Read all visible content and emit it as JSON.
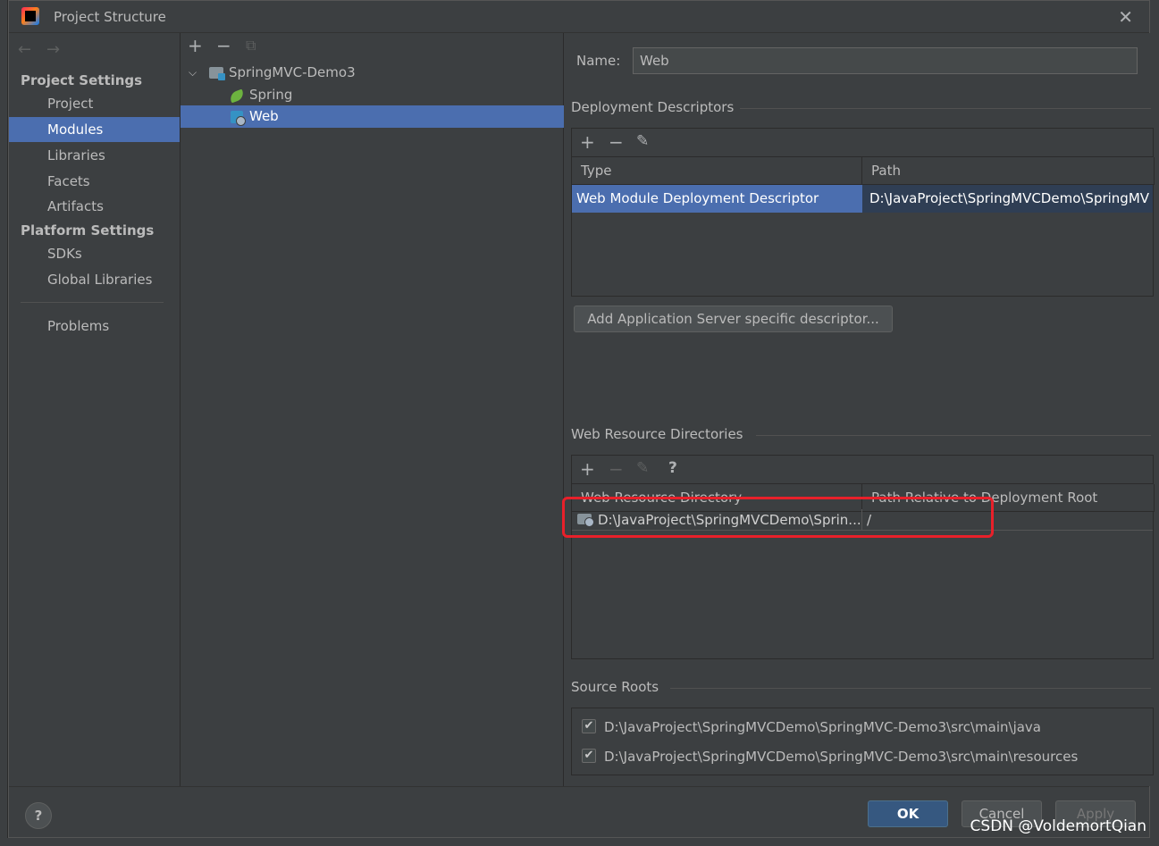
{
  "window": {
    "title": "Project Structure"
  },
  "nav": {
    "back_icon": "arrow-left-icon",
    "forward_icon": "arrow-right-icon",
    "project_settings_heading": "Project Settings",
    "project_items": [
      "Project",
      "Modules",
      "Libraries",
      "Facets",
      "Artifacts"
    ],
    "selected_item": "Modules",
    "platform_settings_heading": "Platform Settings",
    "platform_items": [
      "SDKs",
      "Global Libraries"
    ],
    "problems_label": "Problems"
  },
  "tree": {
    "toolbar": {
      "add": "+",
      "remove": "−",
      "copy_icon": "copy-icon"
    },
    "root": "SpringMVC-Demo3",
    "children": [
      "Spring",
      "Web"
    ],
    "selected": "Web"
  },
  "facet": {
    "name_label": "Name:",
    "name_value": "Web",
    "deployment": {
      "title": "Deployment Descriptors",
      "columns": [
        "Type",
        "Path"
      ],
      "rows": [
        {
          "type": "Web Module Deployment Descriptor",
          "path": "D:\\JavaProject\\SpringMVCDemo\\SpringMV"
        }
      ],
      "add_server_button": "Add Application Server specific descriptor..."
    },
    "web_resources": {
      "title": "Web Resource Directories",
      "help": "?",
      "columns": [
        "Web Resource Directory",
        "Path Relative to Deployment Root"
      ],
      "rows": [
        {
          "directory": "D:\\JavaProject\\SpringMVCDemo\\Sprin...",
          "relative": "/"
        }
      ]
    },
    "source_roots": {
      "title": "Source Roots",
      "items": [
        {
          "checked": true,
          "path": "D:\\JavaProject\\SpringMVCDemo\\SpringMVC-Demo3\\src\\main\\java"
        },
        {
          "checked": true,
          "path": "D:\\JavaProject\\SpringMVCDemo\\SpringMVC-Demo3\\src\\main\\resources"
        }
      ]
    }
  },
  "footer": {
    "help": "?",
    "ok": "OK",
    "cancel": "Cancel",
    "apply": "Apply"
  },
  "watermark": "CSDN @VoldemortQian",
  "colors": {
    "selection": "#4b6eaf",
    "primary_button": "#365880",
    "highlight_box": "#e8202a"
  }
}
